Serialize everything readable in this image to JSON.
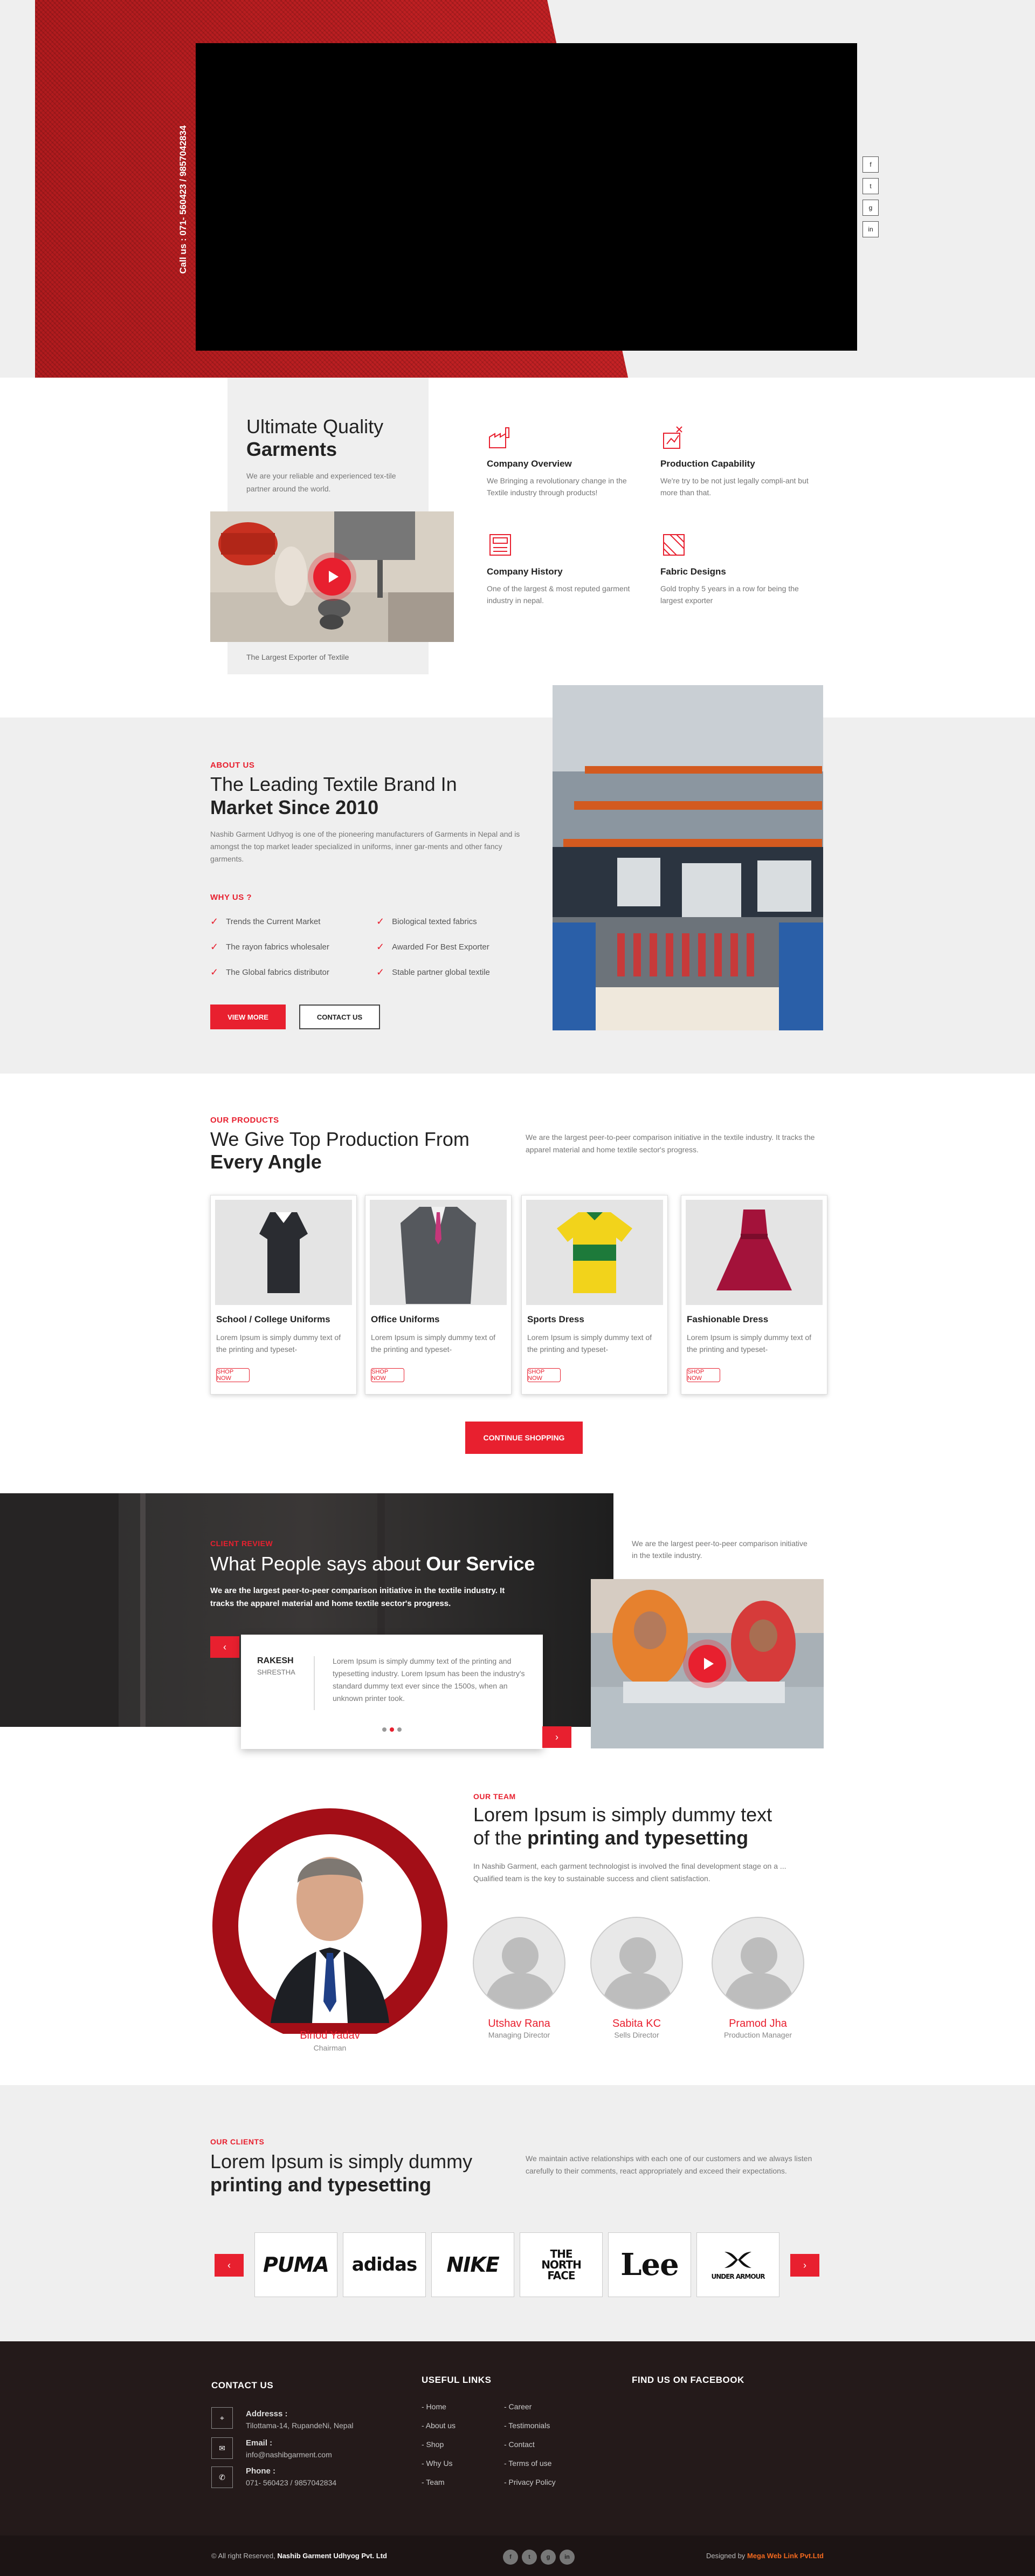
{
  "hero": {
    "call_text": "Call us : 071- 560423 / 9857042834",
    "social": [
      "f",
      "t",
      "g",
      "in"
    ]
  },
  "intro": {
    "title_line1": "Ultimate Quality",
    "title_line2": "Garments",
    "description": "We are your reliable and experienced tex-tile partner around the world.",
    "image_caption": "The Largest Exporter of Textile",
    "features": [
      {
        "title": "Company Overview",
        "text": "We Bringing a revolutionary change in the Textile industry through products!"
      },
      {
        "title": "Production Capability",
        "text": "We're try to be not just legally compli-ant but more than that."
      },
      {
        "title": "Company History",
        "text": "One of the largest & most reputed garment industry in nepal."
      },
      {
        "title": "Fabric Designs",
        "text": "Gold trophy 5 years in a row for being the largest exporter"
      }
    ]
  },
  "about": {
    "tag": "ABOUT US",
    "title_line1": "The Leading Textile Brand In",
    "title_line2": "Market Since 2010",
    "description": "Nashib Garment Udhyog is one of the pioneering manufacturers of Garments in Nepal and is amongst the top market leader specialized in uniforms, inner gar-ments and other fancy garments.",
    "why_tag": "WHY US ?",
    "reasons_left": [
      "Trends the Current Market",
      "The rayon fabrics wholesaler",
      "The Global fabrics distributor"
    ],
    "reasons_right": [
      "Biological texted fabrics",
      "Awarded For Best Exporter",
      "Stable partner global textile"
    ],
    "btn_more": "VIEW MORE",
    "btn_contact": "CONTACT US"
  },
  "products": {
    "tag": "OUR PRODUCTS",
    "title_line1": "We Give Top Production From",
    "title_line2": "Every Angle",
    "description": "We are the largest peer-to-peer comparison initiative in the textile industry. It tracks the apparel material and home textile sector's progress.",
    "items": [
      {
        "name": "School / College Uniforms",
        "text": "Lorem Ipsum is simply dummy text of the printing and typeset-",
        "button": "SHOP NOW"
      },
      {
        "name": "Office Uniforms",
        "text": "Lorem Ipsum is simply dummy text of the printing and typeset-",
        "button": "SHOP NOW"
      },
      {
        "name": "Sports Dress",
        "text": "Lorem Ipsum is simply dummy text of the printing and typeset-",
        "button": "SHOP NOW"
      },
      {
        "name": "Fashionable Dress",
        "text": "Lorem Ipsum is simply dummy text of the printing and typeset-",
        "button": "SHOP NOW"
      }
    ],
    "continue": "CONTINUE SHOPPING"
  },
  "review": {
    "tag": "CLIENT REVIEW",
    "title_plain": "What People says about ",
    "title_bold": "Our Service",
    "description": "We are the largest peer-to-peer comparison initiative in the textile industry. It tracks the apparel material and home textile sector's progress.",
    "side_text": "We are the largest peer-to-peer comparison initiative in the textile industry.",
    "reviewer_first": "RAKESH",
    "reviewer_last": "SHRESTHA",
    "quote": "Lorem Ipsum is simply dummy text of the printing and typesetting industry. Lorem Ipsum has been the industry's standard dummy text ever since the 1500s, when an unknown printer took."
  },
  "team": {
    "tag": "OUR TEAM",
    "title_line1": "Lorem Ipsum is simply dummy text",
    "title_line2_plain": "of the ",
    "title_line2_bold": "printing and typesetting",
    "description": "In Nashib Garment, each garment technologist is involved the final development stage on a ... Qualified team is the key to sustainable success and client satisfaction.",
    "chairman": {
      "name": "Binod  Yadav",
      "role": "Chairman"
    },
    "members": [
      {
        "name": "Utshav Rana",
        "role": "Managing Director"
      },
      {
        "name": "Sabita  KC",
        "role": "Sells Director"
      },
      {
        "name": "Pramod Jha",
        "role": "Production Manager"
      }
    ]
  },
  "clients": {
    "tag": "OUR CLIENTS",
    "title_line1": "Lorem Ipsum is simply dummy",
    "title_line2": "printing and typesetting",
    "description": "We maintain active relationships with each one of our customers and we always listen carefully to their comments, react appropriately and exceed their expectations.",
    "logos": [
      "PUMA",
      "adidas",
      "NIKE",
      "THE NORTH FACE",
      "Lee",
      "UNDER ARMOUR"
    ]
  },
  "footer": {
    "contact_head": "CONTACT US",
    "address_label": "Addresss :",
    "address": "Tilottama-14, RupandeNi, Nepal",
    "email_label": "Email :",
    "email": "info@nashibgarment.com",
    "phone_label": "Phone :",
    "phone": "071- 560423 / 9857042834",
    "links_head": "USEFUL LINKS",
    "links_left": [
      "- Home",
      "- About us",
      "- Shop",
      "- Why Us",
      "- Team"
    ],
    "links_right": [
      "- Career",
      "- Testimonials",
      "- Contact",
      "- Terms of use",
      "- Privacy Policy"
    ],
    "facebook_head": "FIND US ON FACEBOOK",
    "copyright_prefix": "© All right Reserved,",
    "copyright_company": "Nashib Garment Udhyog Pvt. Ltd",
    "designed_prefix": "Designed by",
    "designed_company": "Mega Web Link Pvt.Ltd",
    "social": [
      "f",
      "t",
      "g",
      "in"
    ]
  },
  "colors": {
    "accent": "#e8202f",
    "footer": "#241a1a",
    "hero_red": "#b51e21"
  }
}
